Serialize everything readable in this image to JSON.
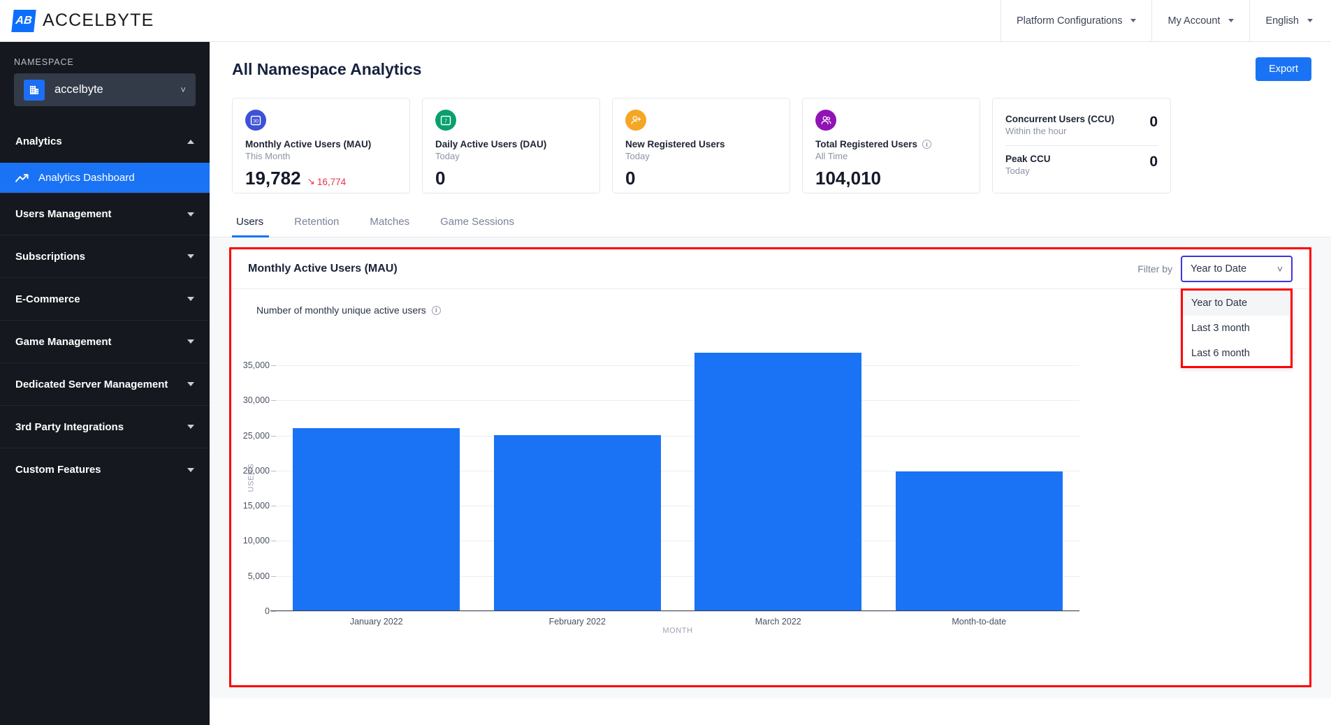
{
  "topbar": {
    "brand": "ACCELBYTE",
    "brand_mark": "AB",
    "items": [
      {
        "label": "Platform Configurations",
        "icon": "chevron-down-icon"
      },
      {
        "label": "My Account",
        "icon": "chevron-down-icon"
      },
      {
        "label": "English",
        "icon": "chevron-down-icon"
      }
    ]
  },
  "sidebar": {
    "namespace_label": "NAMESPACE",
    "namespace_value": "accelbyte",
    "namespace_icon": "building-icon",
    "sections": [
      {
        "label": "Analytics",
        "expanded": true,
        "sub": [
          {
            "label": "Analytics Dashboard",
            "icon": "trending-up-icon",
            "active": true
          }
        ]
      },
      {
        "label": "Users Management",
        "expanded": false,
        "sub": []
      },
      {
        "label": "Subscriptions",
        "expanded": false,
        "sub": []
      },
      {
        "label": "E-Commerce",
        "expanded": false,
        "sub": []
      },
      {
        "label": "Game Management",
        "expanded": false,
        "sub": []
      },
      {
        "label": "Dedicated Server Management",
        "expanded": false,
        "sub": []
      },
      {
        "label": "3rd Party Integrations",
        "expanded": false,
        "sub": []
      },
      {
        "label": "Custom Features",
        "expanded": false,
        "sub": []
      }
    ]
  },
  "page": {
    "title": "All Namespace Analytics",
    "export_label": "Export"
  },
  "kpis": [
    {
      "title": "Monthly Active Users (MAU)",
      "sub": "This Month",
      "value": "19,782",
      "delta": "16,774",
      "delta_dir": "down",
      "icon": "calendar-30-icon",
      "icon_glyph": "30",
      "color": "#3d52d5"
    },
    {
      "title": "Daily Active Users (DAU)",
      "sub": "Today",
      "value": "0",
      "delta": "",
      "icon": "calendar-7-icon",
      "icon_glyph": "7",
      "color": "#0aa06e"
    },
    {
      "title": "New Registered Users",
      "sub": "Today",
      "value": "0",
      "delta": "",
      "icon": "user-plus-icon",
      "icon_glyph": "☺",
      "color": "#f5a623"
    },
    {
      "title": "Total Registered Users",
      "sub": "All Time",
      "value": "104,010",
      "delta": "",
      "has_info": true,
      "icon": "users-icon",
      "icon_glyph": "☺",
      "color": "#9013b5"
    }
  ],
  "ccu_card": {
    "rows": [
      {
        "title": "Concurrent Users (CCU)",
        "sub": "Within the hour",
        "value": "0"
      },
      {
        "title": "Peak CCU",
        "sub": "Today",
        "value": "0"
      }
    ]
  },
  "tabs": [
    {
      "label": "Users",
      "active": true
    },
    {
      "label": "Retention",
      "active": false
    },
    {
      "label": "Matches",
      "active": false
    },
    {
      "label": "Game Sessions",
      "active": false
    }
  ],
  "chart_panel": {
    "title": "Monthly Active Users (MAU)",
    "subtitle": "Number of monthly unique active users",
    "filter_label": "Filter by",
    "filter_value": "Year to Date",
    "dropdown_open": true,
    "dropdown_options": [
      {
        "label": "Year to Date",
        "selected": true
      },
      {
        "label": "Last 3 month",
        "selected": false
      },
      {
        "label": "Last 6 month",
        "selected": false
      }
    ]
  },
  "chart_data": {
    "type": "bar",
    "title": "Monthly Active Users (MAU)",
    "subtitle": "Number of monthly unique active users",
    "categories": [
      "January 2022",
      "February 2022",
      "March 2022",
      "Month-to-date"
    ],
    "values": [
      26000,
      25000,
      36700,
      19782
    ],
    "series": [
      {
        "name": "Monthly Active Users",
        "values": [
          26000,
          25000,
          36700,
          19782
        ],
        "color": "#1a73f5"
      }
    ],
    "xlabel": "MONTH",
    "ylabel": "USERS",
    "ylim": [
      0,
      38000
    ],
    "yticks": [
      0,
      5000,
      10000,
      15000,
      20000,
      25000,
      30000,
      35000
    ],
    "ytick_labels": [
      "0",
      "5,000",
      "10,000",
      "15,000",
      "20,000",
      "25,000",
      "30,000",
      "35,000"
    ],
    "grid": true,
    "legend": false,
    "bar_color": "#1a73f5"
  },
  "colors": {
    "accent": "#1a73f5",
    "sidebar_bg": "#15181f",
    "highlight_border": "#ff0000",
    "select_border": "#3c35e0",
    "danger": "#e8334a"
  }
}
